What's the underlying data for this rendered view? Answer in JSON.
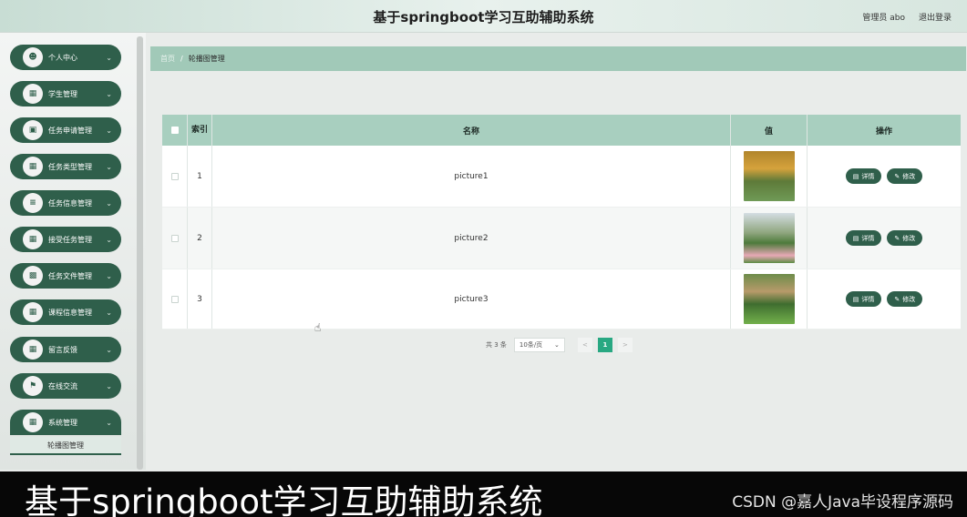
{
  "header": {
    "title": "基于springboot学习互助辅助系统",
    "user": "管理员 abo",
    "logout": "退出登录"
  },
  "sidebar": {
    "items": [
      {
        "label": "个人中心",
        "icon": "user-icon"
      },
      {
        "label": "学生管理",
        "icon": "grid-icon"
      },
      {
        "label": "任务申请管理",
        "icon": "doc-icon"
      },
      {
        "label": "任务类型管理",
        "icon": "grid-icon"
      },
      {
        "label": "任务信息管理",
        "icon": "list-icon"
      },
      {
        "label": "接受任务管理",
        "icon": "grid-icon"
      },
      {
        "label": "任务文件管理",
        "icon": "chart-icon"
      },
      {
        "label": "课程信息管理",
        "icon": "grid-icon"
      },
      {
        "label": "留言反馈",
        "icon": "grid-icon"
      },
      {
        "label": "在线交流",
        "icon": "flag-icon"
      },
      {
        "label": "系统管理",
        "icon": "grid-icon"
      }
    ],
    "submenu": "轮播图管理"
  },
  "breadcrumb": {
    "home": "首页",
    "separator": "/",
    "current": "轮播图管理"
  },
  "table": {
    "headers": {
      "index": "索引",
      "name": "名称",
      "image": "值",
      "actions": "操作"
    },
    "rows": [
      {
        "index": "1",
        "name": "picture1"
      },
      {
        "index": "2",
        "name": "picture2"
      },
      {
        "index": "3",
        "name": "picture3"
      }
    ],
    "detail_label": "详情",
    "edit_label": "修改"
  },
  "pagination": {
    "total": "共 3 条",
    "page_size": "10条/页",
    "current_page": "1",
    "prev": "<",
    "next": ">"
  },
  "caption": {
    "text": "基于springboot学习互助辅助系统",
    "watermark": "CSDN @嘉人Java毕设程序源码"
  }
}
